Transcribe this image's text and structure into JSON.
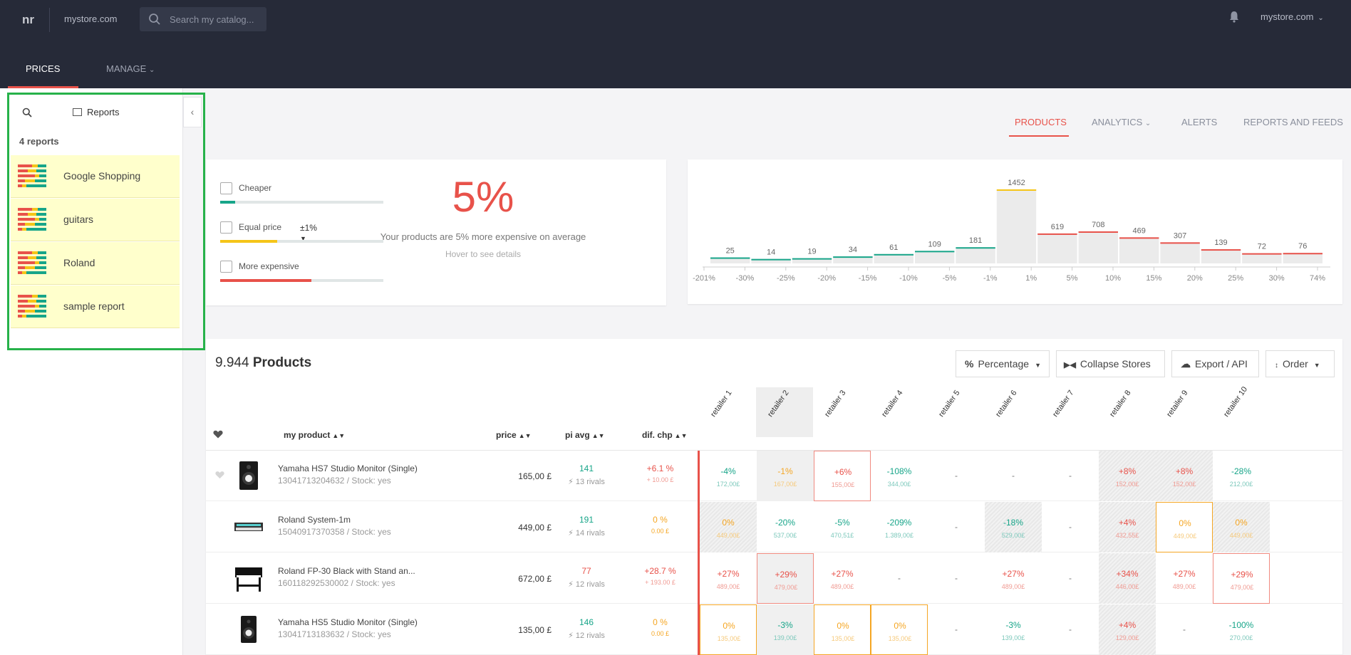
{
  "header": {
    "logo": "nr",
    "store_link": "mystore.com",
    "search_placeholder": "Search my catalog...",
    "account": "mystore.com",
    "nav": [
      {
        "label": "PRICES"
      },
      {
        "label": "MANAGE"
      }
    ]
  },
  "sidebar": {
    "title": "Reports",
    "count_label": "4 reports",
    "collapse_glyph": "‹",
    "reports": [
      {
        "label": "Google Shopping"
      },
      {
        "label": "guitars"
      },
      {
        "label": "Roland"
      },
      {
        "label": "sample report"
      }
    ]
  },
  "main_tabs": {
    "products": "PRODUCTS",
    "analytics": "ANALYTICS",
    "alerts": "ALERTS",
    "feeds": "REPORTS AND FEEDS"
  },
  "summary": {
    "filters": [
      {
        "label": "Cheaper",
        "fill": 0.09,
        "color": "#17a589"
      },
      {
        "label": "Equal price",
        "fill": 0.35,
        "color": "#f5c518"
      },
      {
        "label": "More expensive",
        "fill": 0.56,
        "color": "#e8524a"
      }
    ],
    "tolerance": "±1%",
    "big_percent": "5%",
    "description": "Your products are 5% more expensive on average",
    "hint": "Hover to see details"
  },
  "histogram": {
    "counts": [
      25,
      14,
      19,
      34,
      61,
      109,
      181,
      1452,
      619,
      708,
      469,
      307,
      139,
      72,
      76
    ],
    "axis_ticks": [
      "-201%",
      "-30%",
      "-25%",
      "-20%",
      "-15%",
      "-10%",
      "-5%",
      "-1%",
      "1%",
      "5%",
      "10%",
      "15%",
      "20%",
      "25%",
      "30%",
      "74%"
    ],
    "colors": {
      "cheaper": "#17a589",
      "equal": "#f5c518",
      "expensive": "#e8524a"
    }
  },
  "products": {
    "count": "9.944",
    "count_label": "Products",
    "buttons": {
      "percentage": "Percentage",
      "collapse": "Collapse Stores",
      "export": "Export / API",
      "order": "Order"
    },
    "columns": {
      "my_product": "my product",
      "price": "price",
      "pi_avg": "pi avg",
      "dif_chp": "dif. chp"
    },
    "retailers": [
      "retailer 1",
      "retailer 2",
      "retailer 3",
      "retailer 4",
      "retailer 5",
      "retailer 6",
      "retailer 7",
      "retailer 8",
      "retailer 9",
      "retailer 10"
    ],
    "rows": [
      {
        "name": "Yamaha HS7 Studio Monitor (Single)",
        "sku": "13041713204632 / Stock: yes",
        "price": "165,00 £",
        "pi_avg": "141",
        "rivals": "13 rivals",
        "dif": "+6.1 %",
        "dif_amount": "+ 10.00 £",
        "cells": [
          {
            "pct": "-4%",
            "amt": "172,00£"
          },
          {
            "pct": "-1%",
            "amt": "167,00£"
          },
          {
            "pct": "+6%",
            "amt": "155,00£"
          },
          {
            "pct": "-108%",
            "amt": "344,00£"
          },
          {
            "pct": "-"
          },
          {
            "pct": "-"
          },
          {
            "pct": "-"
          },
          {
            "pct": "+8%",
            "amt": "152,00£"
          },
          {
            "pct": "+8%",
            "amt": "152,00£"
          },
          {
            "pct": "-28%",
            "amt": "212,00£"
          }
        ]
      },
      {
        "name": "Roland System-1m",
        "sku": "15040917370358 / Stock: yes",
        "price": "449,00 £",
        "pi_avg": "191",
        "rivals": "14 rivals",
        "dif": "0 %",
        "dif_amount": "0.00 £",
        "cells": [
          {
            "pct": "0%",
            "amt": "449,00£"
          },
          {
            "pct": "-20%",
            "amt": "537,00£"
          },
          {
            "pct": "-5%",
            "amt": "470,51£"
          },
          {
            "pct": "-209%",
            "amt": "1.389,00£"
          },
          {
            "pct": "-"
          },
          {
            "pct": "-18%",
            "amt": "529,00£"
          },
          {
            "pct": "-"
          },
          {
            "pct": "+4%",
            "amt": "432,55£"
          },
          {
            "pct": "0%",
            "amt": "449,00£"
          },
          {
            "pct": "0%",
            "amt": "449,00£"
          }
        ]
      },
      {
        "name": "Roland FP-30 Black with Stand an...",
        "sku": "160118292530002 / Stock: yes",
        "price": "672,00 £",
        "pi_avg": "77",
        "rivals": "12 rivals",
        "dif": "+28.7 %",
        "dif_amount": "+ 193.00 £",
        "cells": [
          {
            "pct": "+27%",
            "amt": "489,00£"
          },
          {
            "pct": "+29%",
            "amt": "479,00£"
          },
          {
            "pct": "+27%",
            "amt": "489,00£"
          },
          {
            "pct": "-"
          },
          {
            "pct": "-"
          },
          {
            "pct": "+27%",
            "amt": "489,00£"
          },
          {
            "pct": "-"
          },
          {
            "pct": "+34%",
            "amt": "446,00£"
          },
          {
            "pct": "+27%",
            "amt": "489,00£"
          },
          {
            "pct": "+29%",
            "amt": "479,00£"
          }
        ]
      },
      {
        "name": "Yamaha HS5 Studio Monitor (Single)",
        "sku": "13041713183632 / Stock: yes",
        "price": "135,00 £",
        "pi_avg": "146",
        "rivals": "12 rivals",
        "dif": "0 %",
        "dif_amount": "0.00 £",
        "cells": [
          {
            "pct": "0%",
            "amt": "135,00£"
          },
          {
            "pct": "-3%",
            "amt": "139,00£"
          },
          {
            "pct": "0%",
            "amt": "135,00£"
          },
          {
            "pct": "0%",
            "amt": "135,00£"
          },
          {
            "pct": "-"
          },
          {
            "pct": "-3%",
            "amt": "139,00£"
          },
          {
            "pct": "-"
          },
          {
            "pct": "+4%",
            "amt": "129,00£"
          },
          {
            "pct": "-"
          },
          {
            "pct": "-100%",
            "amt": "270,00£"
          }
        ]
      }
    ]
  }
}
